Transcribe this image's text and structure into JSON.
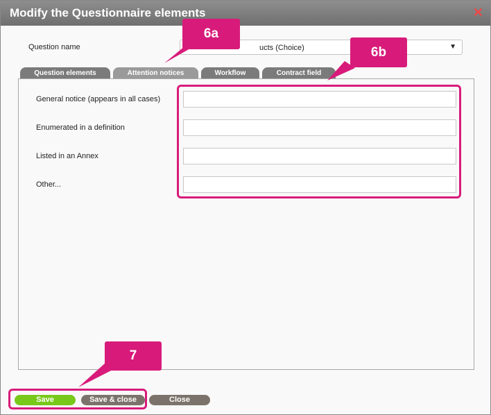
{
  "dialog": {
    "title": "Modify the Questionnaire elements",
    "close_icon": "close-icon"
  },
  "question": {
    "label": "Question name",
    "value": "ucts (Choice)"
  },
  "tabs": [
    {
      "label": "Question elements"
    },
    {
      "label": "Attention notices",
      "active": true
    },
    {
      "label": "Workflow"
    },
    {
      "label": "Contract field"
    }
  ],
  "fields": [
    {
      "label": "General notice (appears in all cases)",
      "value": ""
    },
    {
      "label": "Enumerated in a definition",
      "value": ""
    },
    {
      "label": "Listed in an Annex",
      "value": ""
    },
    {
      "label": "Other...",
      "value": ""
    }
  ],
  "buttons": {
    "save": "Save",
    "save_close": "Save & close",
    "close": "Close"
  },
  "callouts": {
    "tab_callout": "6a",
    "fields_callout": "6b",
    "buttons_callout": "7"
  },
  "colors": {
    "callout": "#d81b7a",
    "save": "#78c81a",
    "button_gray": "#7b736b",
    "close_x": "#f04848"
  }
}
